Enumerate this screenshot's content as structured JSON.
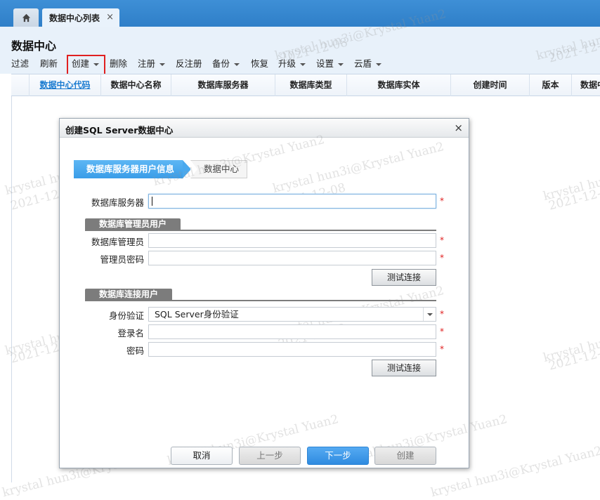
{
  "tabs": {
    "home_icon": "home-icon",
    "active_label": "数据中心列表",
    "close_glyph": "×"
  },
  "page": {
    "title": "数据中心"
  },
  "toolbar": {
    "filter": "过滤",
    "refresh": "刷新",
    "create": "创建",
    "delete": "删除",
    "register": "注册",
    "unregister": "反注册",
    "backup": "备份",
    "restore": "恢复",
    "upgrade": "升级",
    "settings": "设置",
    "cloud_shield": "云盾"
  },
  "grid": {
    "columns": [
      "数据中心代码",
      "数据中心名称",
      "数据库服务器",
      "数据库类型",
      "数据库实体",
      "创建时间",
      "版本",
      "数据中"
    ]
  },
  "dialog": {
    "title": "创建SQL Server数据中心",
    "close_glyph": "×",
    "steps": [
      "数据库服务器用户信息",
      "数据中心"
    ],
    "db_server_label": "数据库服务器",
    "db_server_value": "",
    "admin_section": "数据库管理员用户",
    "admin_user_label": "数据库管理员",
    "admin_user_value": "",
    "admin_password_label": "管理员密码",
    "admin_password_value": "",
    "test_button": "测试连接",
    "conn_section": "数据库连接用户",
    "auth_label": "身份验证",
    "auth_value": "SQL Server身份验证",
    "login_label": "登录名",
    "login_value": "",
    "password_label": "密码",
    "password_value": "",
    "required_mark": "*",
    "footer": {
      "cancel": "取消",
      "prev": "上一步",
      "next": "下一步",
      "create": "创建"
    }
  },
  "watermark": {
    "text1": "krystal hun3i@Krystal Yuan2",
    "text2": "2021-12-08"
  },
  "colors": {
    "topbar": "#2f7fc8",
    "header_bg": "#e8f1fa",
    "step_active": "#4aa9ee",
    "next_button": "#2f8be0",
    "highlight_box": "#e02020"
  }
}
